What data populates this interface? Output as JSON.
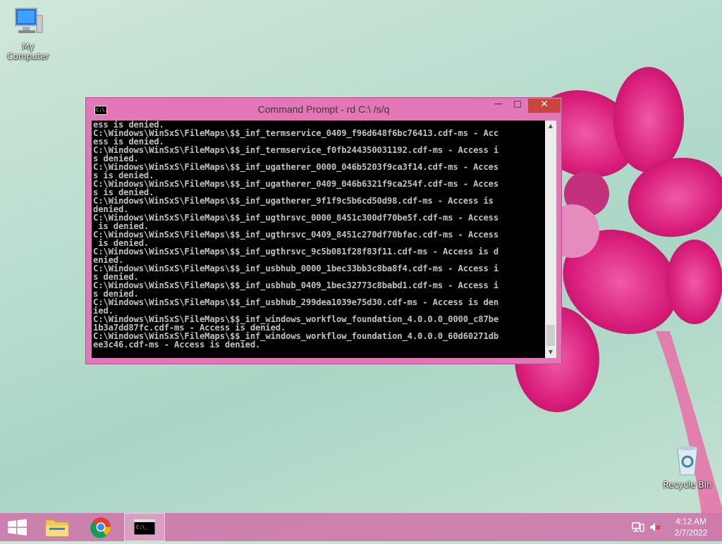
{
  "desktop": {
    "icons": [
      {
        "label": "My Computer"
      },
      {
        "label": "Recycle Bin"
      }
    ]
  },
  "window": {
    "title": "Command Prompt - rd  C:\\ /s/q",
    "minimize_glyph": "—",
    "maximize_glyph": "□",
    "close_glyph": "✕",
    "icon_text": "C:\\.",
    "console_lines": [
      "ess is denied.",
      "C:\\Windows\\WinSxS\\FileMaps\\$$_inf_termservice_0409_f96d648f6bc76413.cdf-ms - Acc",
      "ess is denied.",
      "C:\\Windows\\WinSxS\\FileMaps\\$$_inf_termservice_f0fb244350031192.cdf-ms - Access i",
      "s denied.",
      "C:\\Windows\\WinSxS\\FileMaps\\$$_inf_ugatherer_0000_046b5203f9ca3f14.cdf-ms - Acces",
      "s is denied.",
      "C:\\Windows\\WinSxS\\FileMaps\\$$_inf_ugatherer_0409_046b6321f9ca254f.cdf-ms - Acces",
      "s is denied.",
      "C:\\Windows\\WinSxS\\FileMaps\\$$_inf_ugatherer_9f1f9c5b6cd50d98.cdf-ms - Access is",
      "denied.",
      "C:\\Windows\\WinSxS\\FileMaps\\$$_inf_ugthrsvc_0000_8451c300df70be5f.cdf-ms - Access",
      " is denied.",
      "C:\\Windows\\WinSxS\\FileMaps\\$$_inf_ugthrsvc_0409_8451c270df70bfac.cdf-ms - Access",
      " is denied.",
      "C:\\Windows\\WinSxS\\FileMaps\\$$_inf_ugthrsvc_9c5b081f28f83f11.cdf-ms - Access is d",
      "enied.",
      "C:\\Windows\\WinSxS\\FileMaps\\$$_inf_usbhub_0000_1bec33bb3c8ba8f4.cdf-ms - Access i",
      "s denied.",
      "C:\\Windows\\WinSxS\\FileMaps\\$$_inf_usbhub_0409_1bec32773c8babd1.cdf-ms - Access i",
      "s denied.",
      "C:\\Windows\\WinSxS\\FileMaps\\$$_inf_usbhub_299dea1039e75d30.cdf-ms - Access is den",
      "ied.",
      "C:\\Windows\\WinSxS\\FileMaps\\$$_inf_windows_workflow_foundation_4.0.0.0_0000_c87be",
      "1b3a7dd87fc.cdf-ms - Access is denied.",
      "C:\\Windows\\WinSxS\\FileMaps\\$$_inf_windows_workflow_foundation_4.0.0.0_60d60271db",
      "ee3c46.cdf-ms - Access is denied."
    ]
  },
  "taskbar": {
    "items": [
      {
        "name": "start-button"
      },
      {
        "name": "file-explorer-icon"
      },
      {
        "name": "chrome-icon"
      },
      {
        "name": "command-prompt-icon"
      }
    ],
    "clock": {
      "time": "4:12 AM",
      "date": "2/7/2022"
    }
  },
  "colors": {
    "window_frame": "#e276b6",
    "close_button": "#c9463d",
    "taskbar": "#ce78aa",
    "console_bg": "#000000",
    "console_fg": "#c0c0c0"
  }
}
